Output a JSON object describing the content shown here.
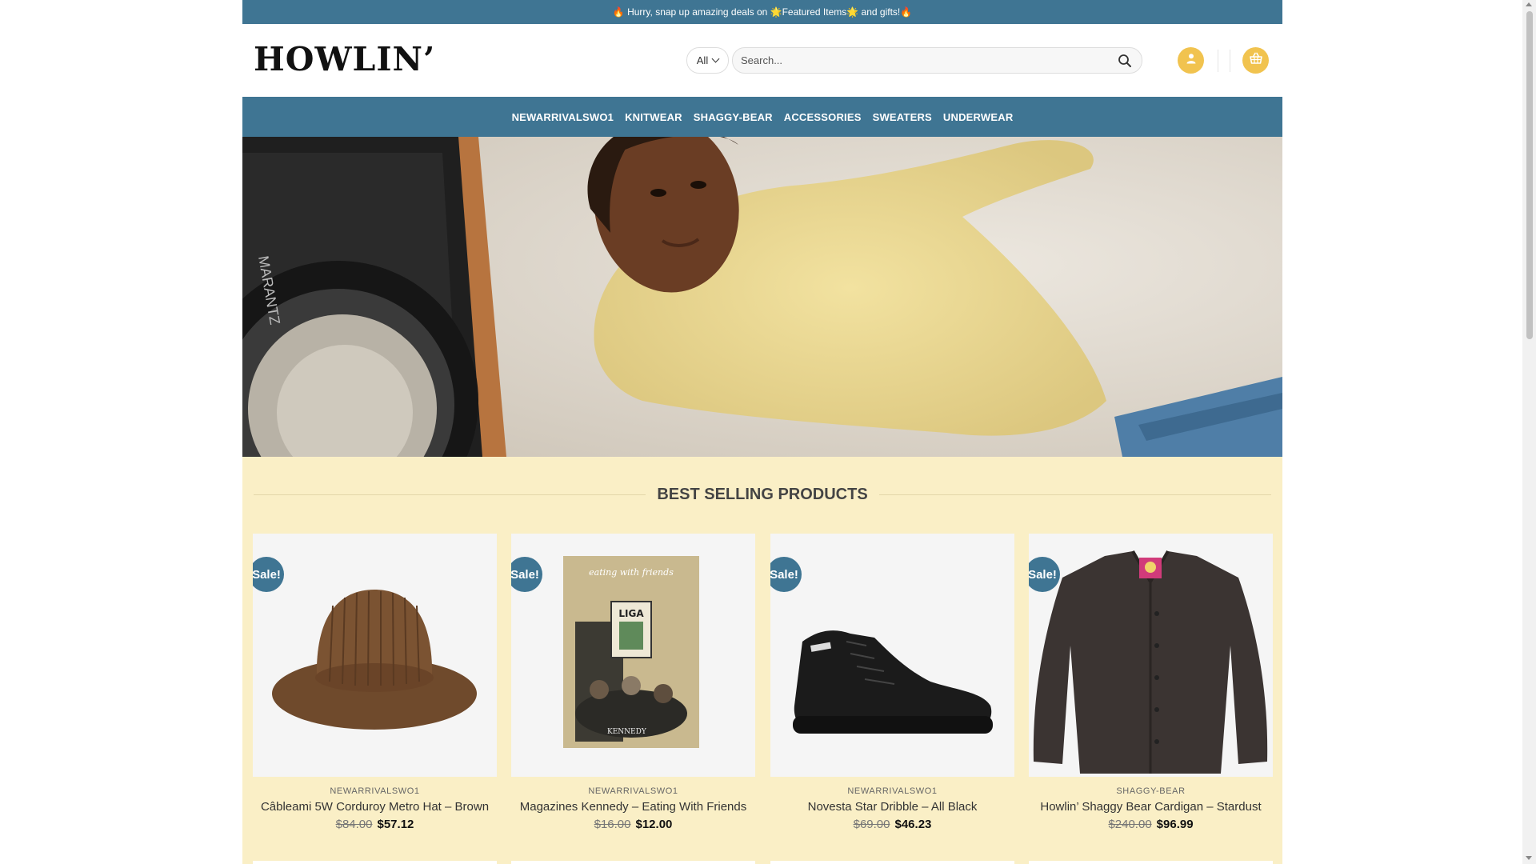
{
  "topbar": {
    "announcement": "🔥 Hurry, snap up amazing deals on 🌟Featured Items🌟 and gifts!🔥"
  },
  "header": {
    "logo": "HOWLIN’",
    "category_select": "All",
    "search_placeholder": "Search...",
    "account_icon": "user-icon",
    "cart_icon": "basket-icon"
  },
  "nav": {
    "items": [
      {
        "label": "NEWARRIVALSWO1"
      },
      {
        "label": "KNITWEAR"
      },
      {
        "label": "SHAGGY-BEAR"
      },
      {
        "label": "ACCESSORIES"
      },
      {
        "label": "SWEATERS"
      },
      {
        "label": "UNDERWEAR"
      }
    ]
  },
  "hero": {
    "image": "hero-photo"
  },
  "best_sellers": {
    "title": "BEST SELLING PRODUCTS",
    "products": [
      {
        "badge": "Sale!",
        "category": "NEWARRIVALSWO1",
        "title": "Câbleami 5W Corduroy Metro Hat – Brown",
        "old_price": "$84.00",
        "price": "$57.12",
        "image": "bucket-hat"
      },
      {
        "badge": "Sale!",
        "category": "NEWARRIVALSWO1",
        "title": "Magazines Kennedy – Eating With Friends",
        "old_price": "$16.00",
        "price": "$12.00",
        "image": "magazine-cover",
        "cover_text": "eating with friends",
        "cover_sign": "LIGA",
        "cover_name": "KENNEDY"
      },
      {
        "badge": "Sale!",
        "category": "NEWARRIVALSWO1",
        "title": "Novesta Star Dribble – All Black",
        "old_price": "$69.00",
        "price": "$46.23",
        "image": "high-top-sneaker"
      },
      {
        "badge": "Sale!",
        "category": "SHAGGY-BEAR",
        "title": "Howlin’ Shaggy Bear Cardigan – Stardust",
        "old_price": "$240.00",
        "price": "$96.99",
        "image": "cardigan"
      }
    ]
  },
  "colors": {
    "brand_blue": "#3f7593",
    "accent_yellow": "#f1c34f",
    "section_bg": "#faefc6"
  }
}
